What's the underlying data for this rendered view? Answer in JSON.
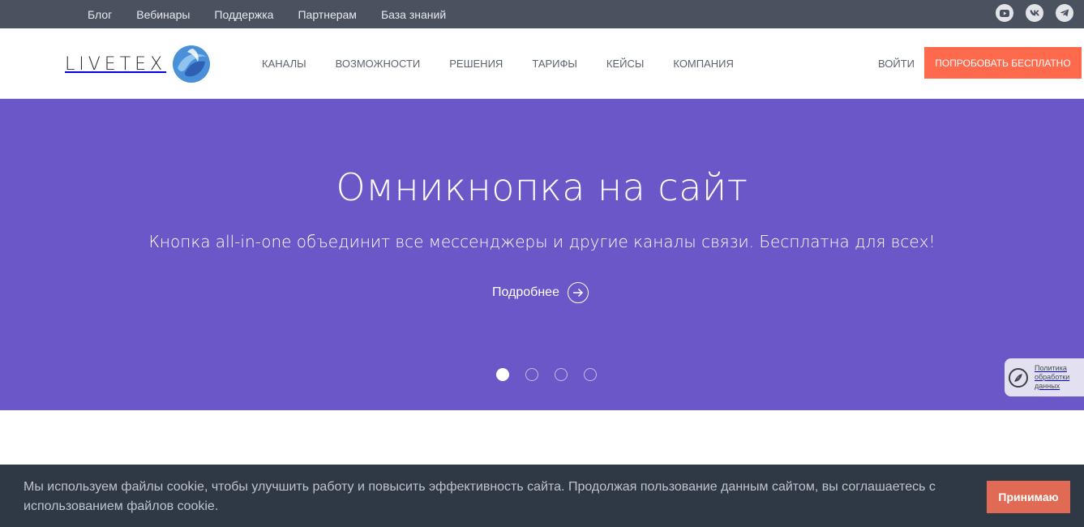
{
  "topbar": {
    "links": [
      "Блог",
      "Вебинары",
      "Поддержка",
      "Партнерам",
      "База знаний"
    ],
    "socials": [
      "youtube-icon",
      "vk-icon",
      "telegram-icon"
    ]
  },
  "header": {
    "logo_text": "LIVETEX",
    "nav": [
      "КАНАЛЫ",
      "ВОЗМОЖНОСТИ",
      "РЕШЕНИЯ",
      "ТАРИФЫ",
      "КЕЙСЫ",
      "КОМПАНИЯ"
    ],
    "login": "ВОЙТИ",
    "cta": "ПОПРОБОВАТЬ БЕСПЛАТНО"
  },
  "hero": {
    "title": "Омникнопка на сайт",
    "subtitle": "Кнопка all-in-one объединит все мессенджеры и другие каналы связи. Бесплатна для всех!",
    "more": "Подробнее",
    "slides_total": 4,
    "active_slide": 1
  },
  "privacy": {
    "label": "Политика обработки данных"
  },
  "cookie": {
    "text": "Мы используем файлы cookie, чтобы улучшить работу и повысить эффективность сайта. Продолжая пользование данным сайтом, вы соглашаетесь с использованием файлов cookie.",
    "accept": "Принимаю"
  },
  "colors": {
    "topbar": "#4a5260",
    "hero": "#6c57c9",
    "cta": "#ff6a4d",
    "cookie_bar": "#2f3946",
    "cookie_button": "#e06a54"
  }
}
